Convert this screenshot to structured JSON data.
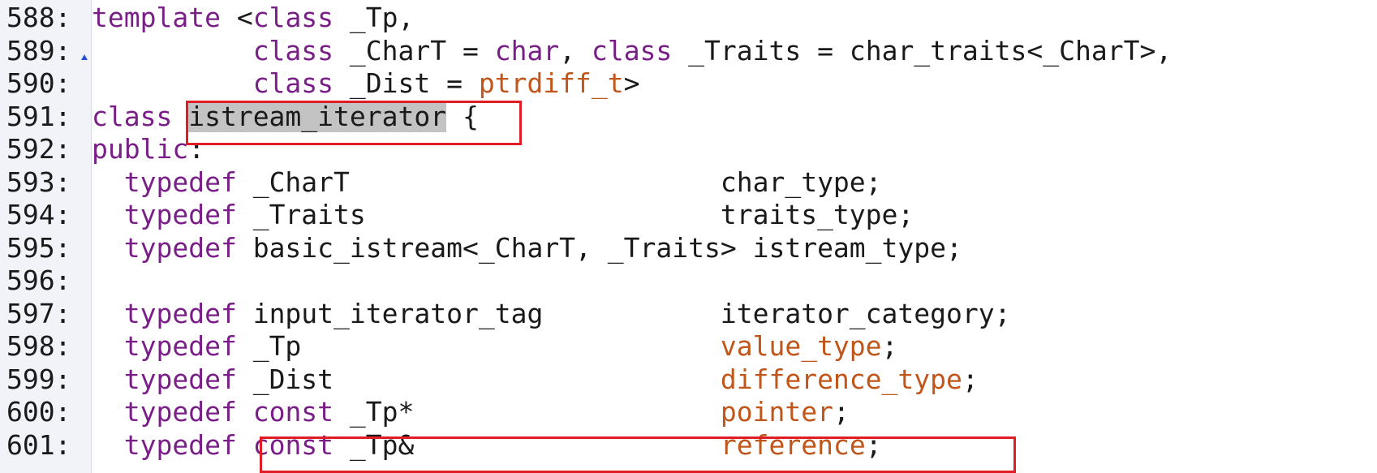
{
  "editor": {
    "lines": [
      {
        "number": "588:",
        "tokens": [
          {
            "t": "template",
            "c": "kw"
          },
          {
            "t": " <",
            "c": "plain"
          },
          {
            "t": "class",
            "c": "kw"
          },
          {
            "t": " _Tp,",
            "c": "plain"
          }
        ]
      },
      {
        "number": "589:",
        "tokens": [
          {
            "t": "          ",
            "c": "plain"
          },
          {
            "t": "class",
            "c": "kw"
          },
          {
            "t": " _CharT = ",
            "c": "plain"
          },
          {
            "t": "char",
            "c": "kw"
          },
          {
            "t": ", ",
            "c": "plain"
          },
          {
            "t": "class",
            "c": "kw"
          },
          {
            "t": " _Traits = char_traits<_CharT>,",
            "c": "plain"
          }
        ]
      },
      {
        "number": "590:",
        "tokens": [
          {
            "t": "          ",
            "c": "plain"
          },
          {
            "t": "class",
            "c": "kw"
          },
          {
            "t": " _Dist = ",
            "c": "plain"
          },
          {
            "t": "ptrdiff_t",
            "c": "type"
          },
          {
            "t": ">",
            "c": "plain"
          }
        ]
      },
      {
        "number": "591:",
        "tokens": [
          {
            "t": "class",
            "c": "kw"
          },
          {
            "t": " ",
            "c": "plain"
          },
          {
            "t": "istream_iterator",
            "c": "hl"
          },
          {
            "t": " {",
            "c": "plain"
          }
        ]
      },
      {
        "number": "592:",
        "tokens": [
          {
            "t": "public",
            "c": "kw"
          },
          {
            "t": ":",
            "c": "plain"
          }
        ]
      },
      {
        "number": "593:",
        "tokens": [
          {
            "t": "  ",
            "c": "plain"
          },
          {
            "t": "typedef",
            "c": "kw"
          },
          {
            "t": " _CharT                       char_type;",
            "c": "plain"
          }
        ]
      },
      {
        "number": "594:",
        "tokens": [
          {
            "t": "  ",
            "c": "plain"
          },
          {
            "t": "typedef",
            "c": "kw"
          },
          {
            "t": " _Traits                      traits_type;",
            "c": "plain"
          }
        ]
      },
      {
        "number": "595:",
        "tokens": [
          {
            "t": "  ",
            "c": "plain"
          },
          {
            "t": "typedef",
            "c": "kw"
          },
          {
            "t": " basic_istream<_CharT, _Traits> istream_type;",
            "c": "plain"
          }
        ]
      },
      {
        "number": "596:",
        "tokens": []
      },
      {
        "number": "597:",
        "tokens": [
          {
            "t": "  ",
            "c": "plain"
          },
          {
            "t": "typedef",
            "c": "kw"
          },
          {
            "t": " input_iterator_tag           iterator_category;",
            "c": "plain"
          }
        ]
      },
      {
        "number": "598:",
        "tokens": [
          {
            "t": "  ",
            "c": "plain"
          },
          {
            "t": "typedef",
            "c": "kw"
          },
          {
            "t": " _Tp                          ",
            "c": "plain"
          },
          {
            "t": "value_type",
            "c": "type"
          },
          {
            "t": ";",
            "c": "plain"
          }
        ]
      },
      {
        "number": "599:",
        "tokens": [
          {
            "t": "  ",
            "c": "plain"
          },
          {
            "t": "typedef",
            "c": "kw"
          },
          {
            "t": " _Dist                        ",
            "c": "plain"
          },
          {
            "t": "difference_type",
            "c": "type"
          },
          {
            "t": ";",
            "c": "plain"
          }
        ]
      },
      {
        "number": "600:",
        "tokens": [
          {
            "t": "  ",
            "c": "plain"
          },
          {
            "t": "typedef",
            "c": "kw"
          },
          {
            "t": " ",
            "c": "plain"
          },
          {
            "t": "const",
            "c": "kw"
          },
          {
            "t": " _Tp*                   ",
            "c": "plain"
          },
          {
            "t": "pointer",
            "c": "type"
          },
          {
            "t": ";",
            "c": "plain"
          }
        ]
      },
      {
        "number": "601:",
        "tokens": [
          {
            "t": "  ",
            "c": "plain"
          },
          {
            "t": "typedef",
            "c": "kw"
          },
          {
            "t": " ",
            "c": "plain"
          },
          {
            "t": "const",
            "c": "kw"
          },
          {
            "t": " _Tp&                   ",
            "c": "plain"
          },
          {
            "t": "reference",
            "c": "type"
          },
          {
            "t": ";",
            "c": "plain"
          }
        ]
      }
    ]
  },
  "colors": {
    "keyword": "#7a1f88",
    "type": "#c0561a",
    "text": "#1a1a1a",
    "highlight": "#c3c3c3",
    "annotation_box": "#e01c24",
    "gutter": "#f1f3f9"
  }
}
